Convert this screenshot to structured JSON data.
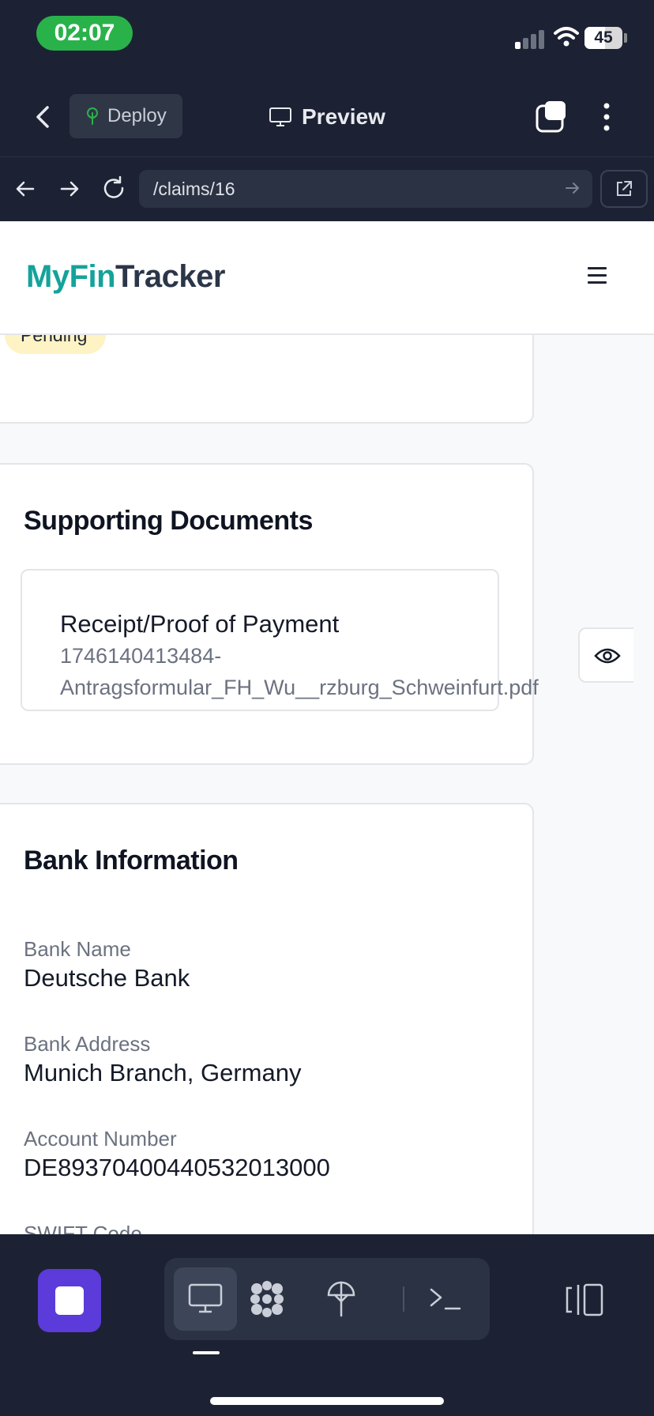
{
  "status_bar": {
    "time": "02:07",
    "battery": "45"
  },
  "toolbar": {
    "deploy_label": "Deploy",
    "preview_label": "Preview"
  },
  "address_bar": {
    "url": "/claims/16"
  },
  "site": {
    "logo_part1": "MyFin",
    "logo_part2": "Tracker"
  },
  "status_card": {
    "badge": "Pending"
  },
  "documents": {
    "title": "Supporting Documents",
    "item_title": "Receipt/Proof of Payment",
    "file_line1": "1746140413484-",
    "file_line2": "Antragsformular_FH_Wu__rzburg_Schweinfurt.pdf"
  },
  "bank": {
    "title": "Bank Information",
    "fields": [
      {
        "label": "Bank Name",
        "value": "Deutsche Bank"
      },
      {
        "label": "Bank Address",
        "value": "Munich Branch, Germany"
      },
      {
        "label": "Account Number",
        "value": "DE89370400440532013000"
      },
      {
        "label": "SWIFT Code",
        "value": ""
      }
    ]
  },
  "colors": {
    "brand_teal": "#14a39a",
    "brand_dark": "#2b3648",
    "badge_bg": "#fdf3c4",
    "accent_purple": "#5b3bd9",
    "chrome_bg": "#1c2233"
  },
  "icons": [
    "signal-icon",
    "wifi-icon",
    "battery-icon",
    "back-chevron-icon",
    "deploy-icon",
    "monitor-icon",
    "tabs-icon",
    "more-vertical-icon",
    "arrow-left-icon",
    "arrow-right-icon",
    "reload-icon",
    "go-arrow-icon",
    "external-link-icon",
    "hamburger-icon",
    "eye-icon",
    "stop-icon",
    "desktop-icon",
    "apps-icon",
    "deploy-tree-icon",
    "terminal-icon",
    "split-view-icon"
  ]
}
